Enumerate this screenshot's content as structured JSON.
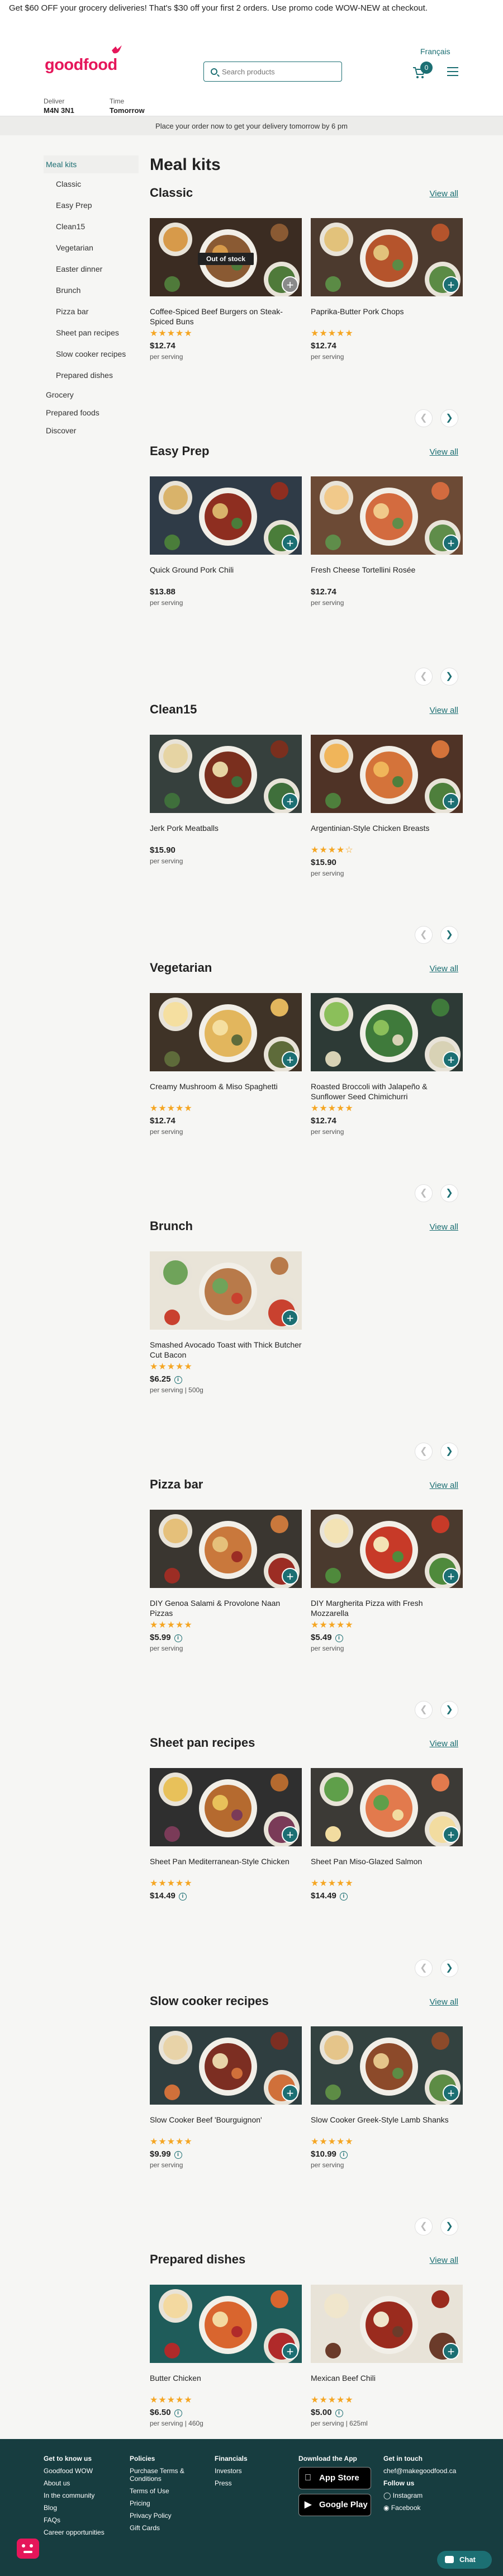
{
  "promo": "Get $60 OFF your grocery deliveries! That's $30 off your first 2 orders. Use promo code WOW-NEW at checkout.",
  "header": {
    "logo": "goodfood",
    "language": "Français",
    "search_placeholder": "Search products",
    "cart_count": "0",
    "deliver_label": "Deliver",
    "deliver_value": "M4N 3N1",
    "time_label": "Time",
    "time_value": "Tomorrow"
  },
  "notice": "Place your order now to get your delivery tomorrow by 6 pm",
  "sidebar": {
    "meal_kits": "Meal kits",
    "sub_items": [
      "Classic",
      "Easy Prep",
      "Clean15",
      "Vegetarian",
      "Easter dinner",
      "Brunch",
      "Pizza bar",
      "Sheet pan recipes",
      "Slow cooker recipes",
      "Prepared dishes"
    ],
    "grocery": "Grocery",
    "prepared_foods": "Prepared foods",
    "discover": "Discover"
  },
  "main": {
    "title": "Meal kits",
    "view_all": "View all",
    "out_of_stock": "Out of stock",
    "stars": "★★★★★"
  },
  "sections": [
    {
      "title": "Classic",
      "products": [
        {
          "name": "Coffee-Spiced Beef Burgers on Steak-Spiced Buns",
          "price": "$12.74",
          "serving": "per serving",
          "rating": 5,
          "image": "burger",
          "out_of_stock": true
        },
        {
          "name": "Paprika-Butter Pork Chops",
          "price": "$12.74",
          "serving": "per serving",
          "rating": 5,
          "image": "pork"
        }
      ]
    },
    {
      "title": "Easy Prep",
      "products": [
        {
          "name": "Quick Ground Pork Chili",
          "price": "$13.88",
          "serving": "per serving",
          "rating": 0,
          "image": "chili"
        },
        {
          "name": "Fresh Cheese Tortellini Rosée",
          "price": "$12.74",
          "serving": "per serving",
          "rating": 0,
          "image": "pasta"
        }
      ]
    },
    {
      "title": "Clean15",
      "products": [
        {
          "name": "Jerk Pork Meatballs",
          "price": "$15.90",
          "serving": "per serving",
          "rating": 0,
          "image": "meatballs"
        },
        {
          "name": "Argentinian-Style Chicken Breasts",
          "price": "$15.90",
          "serving": "per serving",
          "rating": 3.5,
          "image": "sweetpotato"
        }
      ]
    },
    {
      "title": "Vegetarian",
      "products": [
        {
          "name": "Creamy Mushroom & Miso Spaghetti",
          "price": "$12.74",
          "serving": "per serving",
          "rating": 5,
          "image": "spaghetti"
        },
        {
          "name": "Roasted Broccoli with Jalapeño & Sunflower Seed Chimichurri",
          "price": "$12.74",
          "serving": "per serving",
          "rating": 5,
          "image": "broccoli"
        }
      ]
    },
    {
      "title": "Brunch",
      "products": [
        {
          "name": "Smashed Avocado Toast with Thick Butcher Cut Bacon",
          "price": "$6.25",
          "serving": "per serving | 500g",
          "rating": 5,
          "image": "toast",
          "info": true
        }
      ]
    },
    {
      "title": "Pizza bar",
      "products": [
        {
          "name": "DIY Genoa Salami & Provolone Naan Pizzas",
          "price": "$5.99",
          "serving": "per serving",
          "rating": 5,
          "image": "naan",
          "info": true
        },
        {
          "name": "DIY Margherita Pizza with Fresh Mozzarella",
          "price": "$5.49",
          "serving": "per serving",
          "rating": 5,
          "image": "margherita",
          "info": true
        }
      ]
    },
    {
      "title": "Sheet pan recipes",
      "products": [
        {
          "name": "Sheet Pan Mediterranean-Style Chicken",
          "price": "$14.49",
          "serving": "",
          "rating": 5,
          "image": "sheetchicken",
          "info": true
        },
        {
          "name": "Sheet Pan Miso-Glazed Salmon",
          "price": "$14.49",
          "serving": "",
          "rating": 5,
          "image": "salmon",
          "info": true
        }
      ]
    },
    {
      "title": "Slow cooker recipes",
      "products": [
        {
          "name": "Slow Cooker Beef 'Bourguignon'",
          "price": "$9.99",
          "serving": "per serving",
          "rating": 5,
          "image": "bourguignon",
          "info": true
        },
        {
          "name": "Slow Cooker Greek-Style Lamb Shanks",
          "price": "$10.99",
          "serving": "per serving",
          "rating": 5,
          "image": "lamb",
          "info": true
        }
      ]
    },
    {
      "title": "Prepared dishes",
      "products": [
        {
          "name": "Butter Chicken",
          "price": "$6.50",
          "serving": "per serving | 460g",
          "rating": 5,
          "image": "butterchicken",
          "info": true
        },
        {
          "name": "Mexican Beef Chili",
          "price": "$5.00",
          "serving": "per serving | 625ml",
          "rating": 5,
          "image": "beefchili",
          "info": true
        }
      ]
    }
  ],
  "footer": {
    "cols": [
      {
        "title": "Get to know us",
        "links": [
          "Goodfood WOW",
          "About us",
          "In the community",
          "Blog",
          "FAQs",
          "Career opportunities"
        ]
      },
      {
        "title": "Policies",
        "links": [
          "Purchase Terms & Conditions",
          "Terms of Use",
          "Pricing",
          "Privacy Policy",
          "Gift Cards"
        ]
      },
      {
        "title": "Financials",
        "links": [
          "Investors",
          "Press"
        ]
      }
    ],
    "app_title": "Download the App",
    "app_store": "App Store",
    "google_play": "Google Play",
    "contact_title": "Get in touch",
    "email": "chef@makegoodfood.ca",
    "follow": "Follow us",
    "instagram": "Instagram",
    "facebook": "Facebook"
  },
  "chat": "Chat",
  "colors": {
    "brand": "#e5165a",
    "accent": "#1c6f73",
    "footer": "#173d40",
    "star": "#f5a623"
  }
}
